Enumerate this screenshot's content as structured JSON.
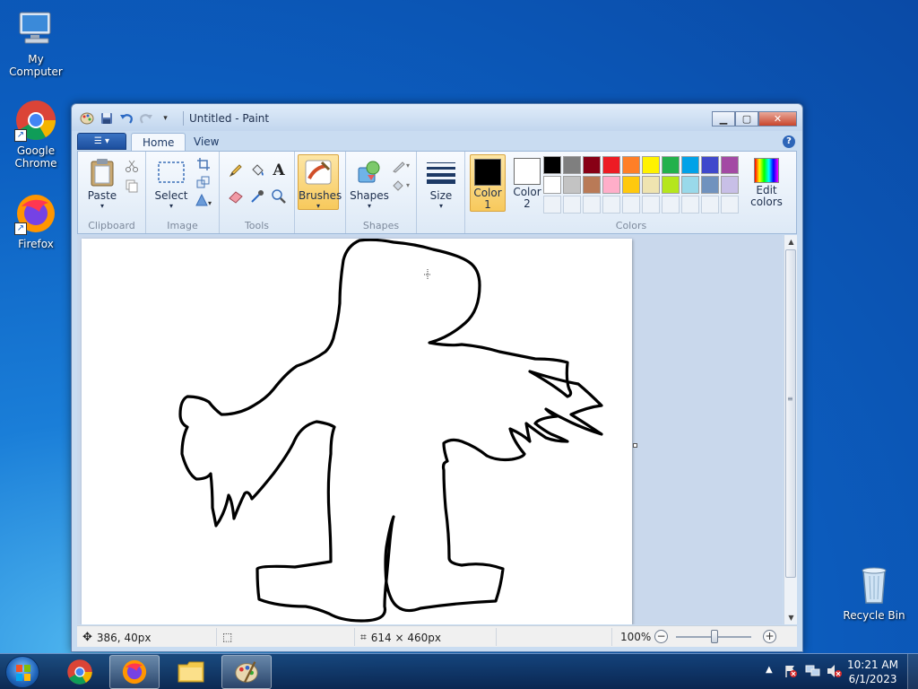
{
  "desktop": {
    "icons": [
      {
        "label": "My Computer"
      },
      {
        "label": "Google Chrome"
      },
      {
        "label": "Firefox"
      },
      {
        "label": "Recycle Bin"
      }
    ]
  },
  "window": {
    "title": "Untitled - Paint"
  },
  "ribbon": {
    "tabs": [
      {
        "label": "Home"
      },
      {
        "label": "View"
      }
    ],
    "groups": {
      "clipboard": {
        "label": "Clipboard",
        "paste": "Paste"
      },
      "image": {
        "label": "Image",
        "select": "Select"
      },
      "tools": {
        "label": "Tools"
      },
      "brushes": {
        "label": "Brushes"
      },
      "shapes": {
        "label": "Shapes",
        "shapes_btn": "Shapes"
      },
      "size": {
        "label": "Size"
      },
      "colors": {
        "label": "Colors",
        "color1_line1": "Color",
        "color1_line2": "1",
        "color2_line1": "Color",
        "color2_line2": "2",
        "edit_line1": "Edit",
        "edit_line2": "colors"
      }
    },
    "color1": "#000000",
    "color2": "#ffffff",
    "palette": [
      "#000000",
      "#7f7f7f",
      "#880015",
      "#ed1c24",
      "#ff7f27",
      "#fff200",
      "#22b14c",
      "#00a2e8",
      "#3f48cc",
      "#a349a4",
      "#ffffff",
      "#c3c3c3",
      "#b97a57",
      "#ffaec9",
      "#ffc90e",
      "#efe4b0",
      "#b5e61d",
      "#99d9ea",
      "#7092be",
      "#c8bfe7"
    ]
  },
  "statusbar": {
    "cursor_pos": "386, 40px",
    "selection_size": "",
    "canvas_size": "614 × 460px",
    "zoom": "100%"
  },
  "taskbar": {
    "time": "10:21 AM",
    "date": "6/1/2023"
  }
}
